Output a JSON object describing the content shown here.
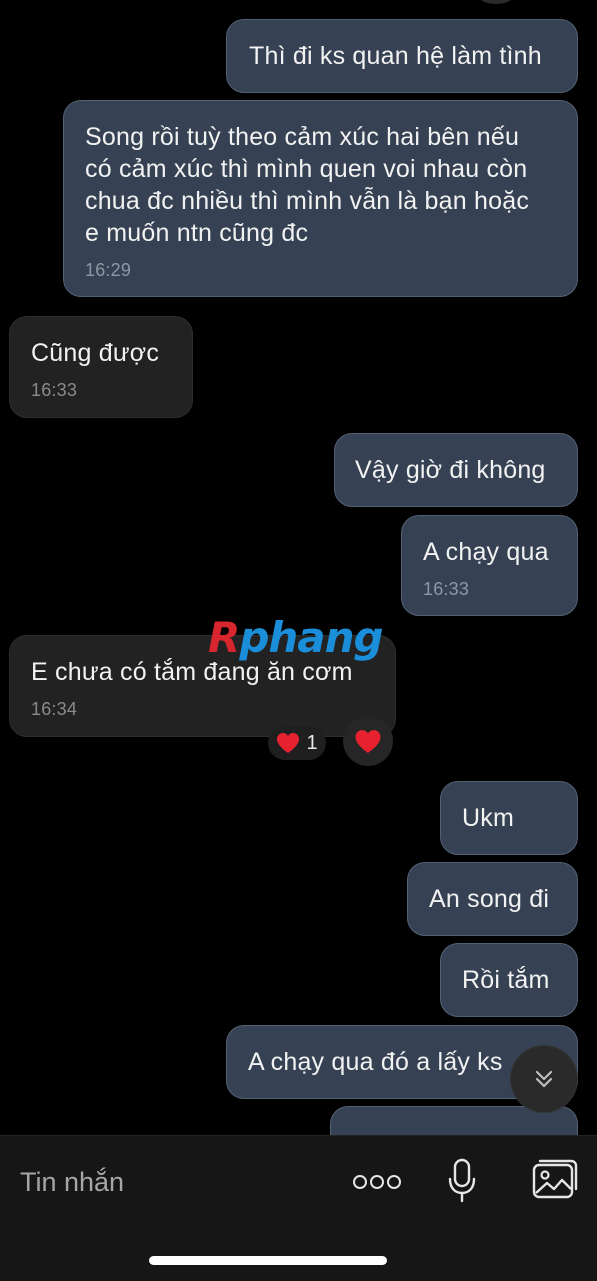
{
  "messages": [
    {
      "direction": "outgoing",
      "text": "Thì đi ks quan hệ làm tình",
      "time": ""
    },
    {
      "direction": "outgoing",
      "text": "Song rồi tuỳ theo cảm xúc hai bên nếu\ncó cảm xúc thì mình quen voi nhau còn\nchua đc nhiều thì mình vẫn là bạn hoặc\ne muốn ntn cũng đc",
      "time": "16:29"
    },
    {
      "direction": "incoming",
      "text": "Cũng được",
      "time": "16:33"
    },
    {
      "direction": "outgoing",
      "text": "Vậy giờ đi không",
      "time": ""
    },
    {
      "direction": "outgoing",
      "text": "A chạy qua",
      "time": "16:33"
    },
    {
      "direction": "incoming",
      "text": "E chưa có tắm đang ăn cơm",
      "time": "16:34"
    },
    {
      "direction": "outgoing",
      "text": "Ukm",
      "time": ""
    },
    {
      "direction": "outgoing",
      "text": "An song đi",
      "time": ""
    },
    {
      "direction": "outgoing",
      "text": "Rồi tắm",
      "time": ""
    },
    {
      "direction": "outgoing",
      "text": "A chạy qua đó a lấy ks",
      "time": ""
    }
  ],
  "reaction": {
    "emoji": "heart",
    "count": "1"
  },
  "watermark": {
    "first": "R",
    "rest": "phang"
  },
  "composer": {
    "placeholder": "Tin nhắn"
  },
  "icons": {
    "more": "more-dots-icon",
    "mic": "microphone-icon",
    "gallery": "image-gallery-icon",
    "scroll": "double-chevron-down-icon"
  },
  "colors": {
    "outgoing_bubble": "#364253",
    "incoming_bubble": "#222222",
    "heart": "#e8212f",
    "watermark_red": "#d8262f",
    "watermark_blue": "#1a8ed8"
  }
}
